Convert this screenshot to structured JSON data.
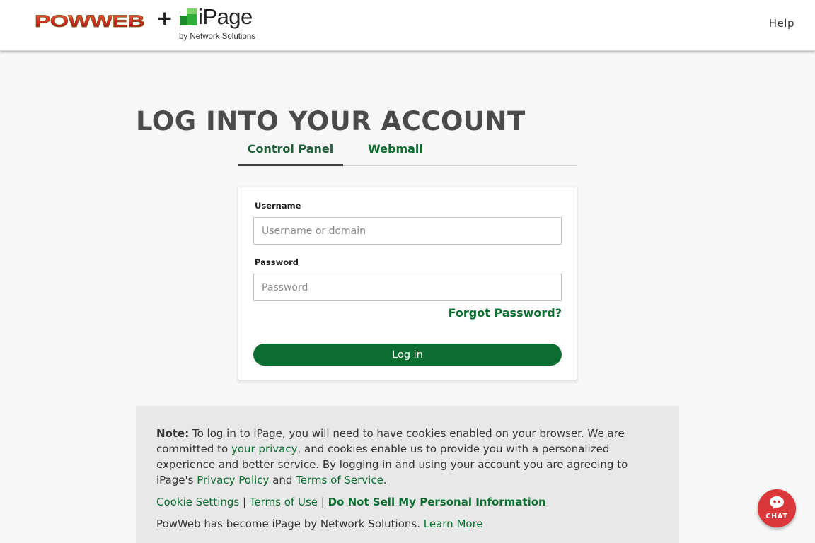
{
  "header": {
    "powweb_logo_text": "POWWEB",
    "plus": "+",
    "ipage_logo_text": "iPage",
    "ipage_logo_sub": "by Network Solutions",
    "help_label": "Help"
  },
  "page_title": "LOG INTO YOUR ACCOUNT",
  "tabs": [
    {
      "label": "Control Panel",
      "active": true
    },
    {
      "label": "Webmail",
      "active": false
    }
  ],
  "login_form": {
    "username_label": "Username",
    "username_placeholder": "Username or domain",
    "username_value": "",
    "password_label": "Password",
    "password_placeholder": "Password",
    "password_value": "",
    "forgot_label": "Forgot Password?",
    "login_button_label": "Log in"
  },
  "note": {
    "lead": "Note:",
    "text_1": " To log in to iPage, you will need to have cookies enabled on your browser. We are committed to ",
    "privacy_link": "your privacy",
    "text_2": ", and cookies enable us to provide you with a personalized experience and better service. By logging in and using your account you are agreeing to iPage's ",
    "privacy_policy_link": "Privacy Policy",
    "text_and": " and ",
    "terms_link": "Terms of Service",
    "text_end": ".",
    "links": {
      "cookie_settings": "Cookie Settings",
      "separator": " | ",
      "terms_of_use": "Terms of Use",
      "do_not_sell": "Do Not Sell My Personal Information"
    },
    "moved_text": "PowWeb has become iPage by Network Solutions. ",
    "learn_more": "Learn More"
  },
  "chat": {
    "label": "CHAT",
    "icon": "chat-bubble-icon"
  },
  "colors": {
    "brand_green": "#0b6e30",
    "chat_red": "#d9373a",
    "ipage_green": "#2fae3a"
  }
}
